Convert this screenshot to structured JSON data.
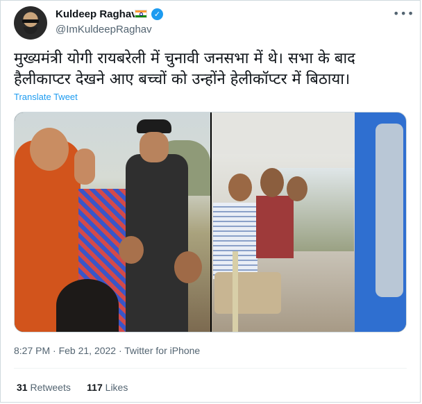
{
  "tweet": {
    "author_name": "Kuldeep Raghav",
    "handle": "@ImKuldeepRaghav",
    "verified_mark": "✓",
    "more_label": "•••",
    "text": "मुख्यमंत्री योगी रायबरेली में चुनावी जनसभा में थे। सभा के बाद हैलीकाप्टर देखने आए बच्चों को उन्होंने हेलीकॉप्टर में बिठाया।",
    "translate_label": "Translate Tweet",
    "timestamp": "8:27 PM · Feb 21, 2022 · Twitter for iPhone",
    "retweets_count": "31",
    "retweets_label": "Retweets",
    "likes_count": "117",
    "likes_label": "Likes"
  },
  "icons": {
    "flag": "india-flag-icon",
    "verified": "verified-badge-icon",
    "more": "more-options-icon"
  },
  "colors": {
    "accent": "#1d9bf0",
    "text_primary": "#0f1419",
    "text_secondary": "#536471",
    "border": "#cfd9de"
  }
}
